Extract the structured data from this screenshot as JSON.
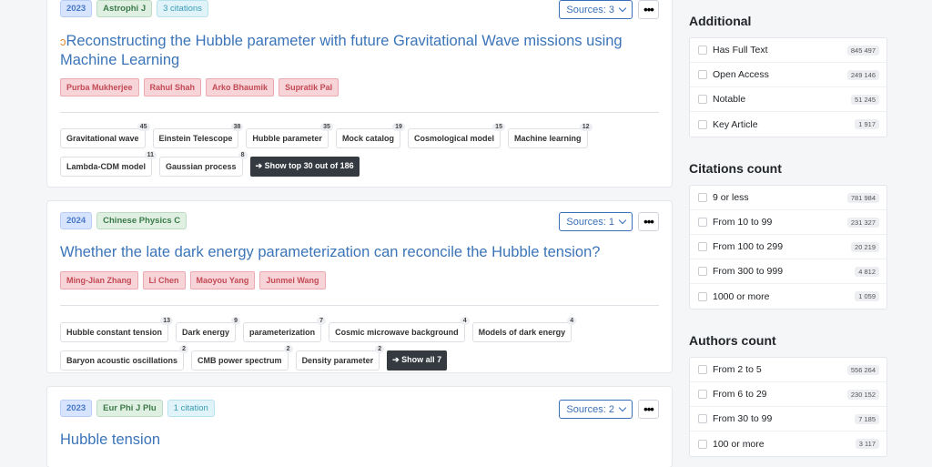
{
  "results": [
    {
      "year": "2023",
      "journal": "Astrophi J",
      "citations": "3 citations",
      "sources": "Sources: 3",
      "open_access": true,
      "title": "Reconstructing the Hubble parameter with future Gravitational Wave missions using Machine Learning",
      "authors": [
        "Purba Mukherjee",
        "Rahul Shah",
        "Arko Bhaumik",
        "Supratik Pal"
      ],
      "keyword_rows": [
        [
          {
            "label": "Gravitational wave",
            "count": "45"
          },
          {
            "label": "Einstein Telescope",
            "count": "38"
          },
          {
            "label": "Hubble parameter",
            "count": "35"
          },
          {
            "label": "Mock catalog",
            "count": "19"
          },
          {
            "label": "Cosmological model",
            "count": "15"
          },
          {
            "label": "Machine learning",
            "count": "12"
          }
        ],
        [
          {
            "label": "Lambda-CDM model",
            "count": "11"
          },
          {
            "label": "Gaussian process",
            "count": "8"
          }
        ]
      ],
      "show_more": "➔ Show top 30 out of 186"
    },
    {
      "year": "2024",
      "journal": "Chinese Physics C",
      "citations": "",
      "sources": "Sources: 1",
      "open_access": false,
      "title": "Whether the late dark energy parameterization can reconcile the Hubble tension?",
      "authors": [
        "Ming-Jian Zhang",
        "Li Chen",
        "Maoyou Yang",
        "Junmei Wang"
      ],
      "keyword_rows": [
        [
          {
            "label": "Hubble constant tension",
            "count": "13"
          },
          {
            "label": "Dark energy",
            "count": "9"
          },
          {
            "label": "parameterization",
            "count": "7"
          },
          {
            "label": "Cosmic microwave background",
            "count": "4"
          },
          {
            "label": "Models of dark energy",
            "count": "4"
          }
        ],
        [
          {
            "label": "Baryon acoustic oscillations",
            "count": "2"
          },
          {
            "label": "CMB power spectrum",
            "count": "2"
          },
          {
            "label": "Density parameter",
            "count": "2"
          }
        ]
      ],
      "show_more": "➔ Show all 7"
    },
    {
      "year": "2023",
      "journal": "Eur Phi J Plu",
      "citations": "1 citation",
      "sources": "Sources: 2",
      "open_access": false,
      "title": "Hubble tension"
    }
  ],
  "sidebar": {
    "additional": {
      "heading": "Additional",
      "items": [
        {
          "label": "Has Full Text",
          "count": "845 497"
        },
        {
          "label": "Open Access",
          "count": "249 146"
        },
        {
          "label": "Notable",
          "count": "51 245"
        },
        {
          "label": "Key Article",
          "count": "1 917"
        }
      ]
    },
    "citations": {
      "heading": "Citations count",
      "items": [
        {
          "label": "9 or less",
          "count": "781 984"
        },
        {
          "label": "From 10 to 99",
          "count": "231 327"
        },
        {
          "label": "From 100 to 299",
          "count": "20 219"
        },
        {
          "label": "From 300 to 999",
          "count": "4 812"
        },
        {
          "label": "1000 or more",
          "count": "1 059"
        }
      ]
    },
    "authors": {
      "heading": "Authors count",
      "items": [
        {
          "label": "From 2 to 5",
          "count": "556 264"
        },
        {
          "label": "From 6 to 29",
          "count": "230 152"
        },
        {
          "label": "From 30 to 99",
          "count": "7 185"
        },
        {
          "label": "100 or more",
          "count": "3 117"
        }
      ]
    }
  }
}
